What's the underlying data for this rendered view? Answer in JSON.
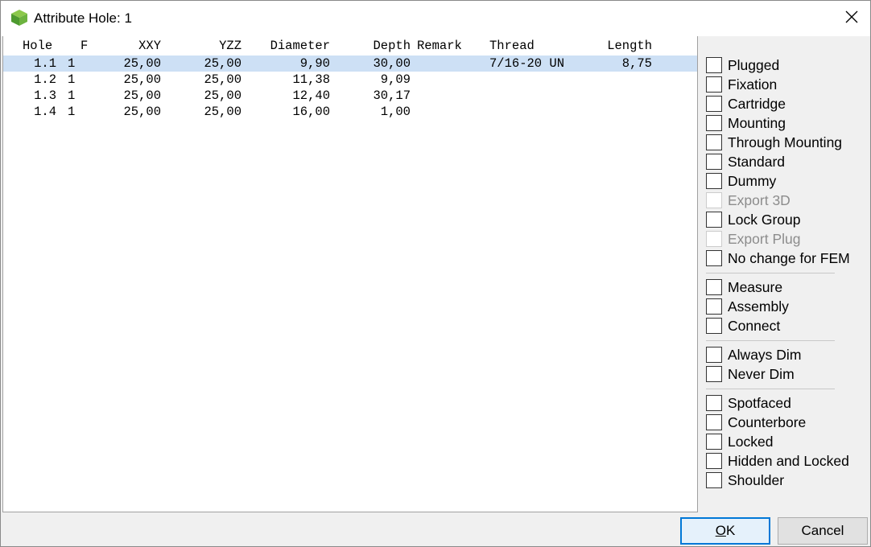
{
  "window": {
    "title": "Attribute Hole: 1"
  },
  "table": {
    "headers": [
      "Hole",
      "F",
      "XXY",
      "YZZ",
      "Diameter",
      "Depth",
      "Remark",
      "Thread",
      "Length"
    ],
    "rows": [
      {
        "hole": "1.1",
        "f": "1",
        "xxy": "25,00",
        "yzz": "25,00",
        "diameter": "9,90",
        "depth": "30,00",
        "remark": "",
        "thread": "7/16-20 UN",
        "length": "8,75",
        "selected": true
      },
      {
        "hole": "1.2",
        "f": "1",
        "xxy": "25,00",
        "yzz": "25,00",
        "diameter": "11,38",
        "depth": "9,09",
        "remark": "",
        "thread": "",
        "length": "",
        "selected": false
      },
      {
        "hole": "1.3",
        "f": "1",
        "xxy": "25,00",
        "yzz": "25,00",
        "diameter": "12,40",
        "depth": "30,17",
        "remark": "",
        "thread": "",
        "length": "",
        "selected": false
      },
      {
        "hole": "1.4",
        "f": "1",
        "xxy": "25,00",
        "yzz": "25,00",
        "diameter": "16,00",
        "depth": "1,00",
        "remark": "",
        "thread": "",
        "length": "",
        "selected": false
      }
    ]
  },
  "checkboxes": {
    "group1": [
      {
        "label": "Plugged",
        "checked": false,
        "enabled": true
      },
      {
        "label": "Fixation",
        "checked": false,
        "enabled": true
      },
      {
        "label": "Cartridge",
        "checked": false,
        "enabled": true
      },
      {
        "label": "Mounting",
        "checked": false,
        "enabled": true
      },
      {
        "label": "Through Mounting",
        "checked": false,
        "enabled": true
      },
      {
        "label": "Standard",
        "checked": false,
        "enabled": true
      },
      {
        "label": "Dummy",
        "checked": false,
        "enabled": true
      },
      {
        "label": "Export 3D",
        "checked": false,
        "enabled": false
      },
      {
        "label": "Lock Group",
        "checked": false,
        "enabled": true
      },
      {
        "label": "Export Plug",
        "checked": false,
        "enabled": false
      },
      {
        "label": "No change for FEM",
        "checked": false,
        "enabled": true
      }
    ],
    "group2": [
      {
        "label": "Measure",
        "checked": false,
        "enabled": true
      },
      {
        "label": "Assembly",
        "checked": false,
        "enabled": true
      },
      {
        "label": "Connect",
        "checked": false,
        "enabled": true
      }
    ],
    "group3": [
      {
        "label": "Always Dim",
        "checked": false,
        "enabled": true
      },
      {
        "label": "Never Dim",
        "checked": false,
        "enabled": true
      }
    ],
    "group4": [
      {
        "label": "Spotfaced",
        "checked": false,
        "enabled": true
      },
      {
        "label": "Counterbore",
        "checked": false,
        "enabled": true
      },
      {
        "label": "Locked",
        "checked": false,
        "enabled": true
      },
      {
        "label": "Hidden and Locked",
        "checked": false,
        "enabled": true
      },
      {
        "label": "Shoulder",
        "checked": false,
        "enabled": true
      }
    ]
  },
  "buttons": {
    "ok_mnemonic": "O",
    "ok_rest": "K",
    "cancel": "Cancel"
  },
  "colors": {
    "selection": "#cde0f5",
    "ok_border": "#0078d7",
    "icon_green": "#5aa53a"
  }
}
